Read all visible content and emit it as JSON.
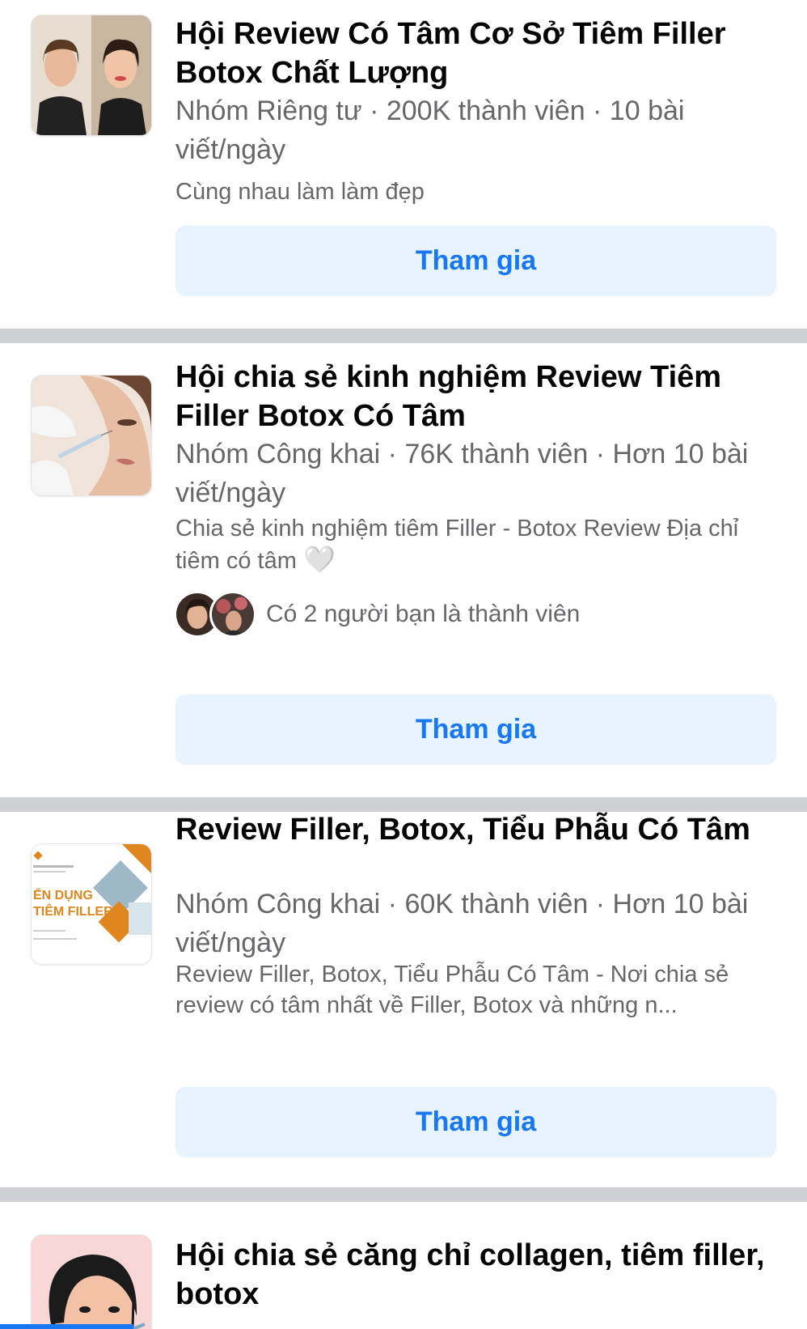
{
  "groups": [
    {
      "title": "Hội Review Có Tâm Cơ Sở Tiêm Filler Botox Chất Lượng",
      "meta": "Nhóm Riêng tư · 200K thành viên · 10 bài viết/ngày",
      "description": "Cùng nhau làm làm đẹp",
      "join_label": "Tham gia",
      "thumbnail_icon": "two-women-portrait-image"
    },
    {
      "title": "Hội chia sẻ kinh nghiệm Review Tiêm Filler Botox Có Tâm",
      "meta": "Nhóm Công khai · 76K thành viên · Hơn 10 bài viết/ngày",
      "description": "Chia sẻ kinh nghiệm tiêm Filler - Botox Review Địa chỉ tiêm có tâm",
      "description_emoji": "🤍",
      "friends_text": "Có 2 người bạn là thành viên",
      "join_label": "Tham gia",
      "thumbnail_icon": "face-injection-image"
    },
    {
      "title": "Review Filler, Botox, Tiểu Phẫu Có Tâm",
      "meta": "Nhóm Công khai · 60K thành viên · Hơn 10 bài viết/ngày",
      "description": "Review Filler, Botox, Tiểu Phẫu Có Tâm - Nơi chia sẻ review có tâm nhất về Filler, Botox và những n...",
      "join_label": "Tham gia",
      "thumbnail_icon": "recruitment-poster-image"
    },
    {
      "title": "Hội chia sẻ căng chỉ collagen, tiêm filler, botox",
      "thumbnail_icon": "cartoon-face-image"
    }
  ],
  "thumbnail_texts": {
    "poster_line1": "ỂN DỤNG",
    "poster_line2": "TIÊM FILLER"
  },
  "colors": {
    "accent": "#1877f2",
    "button_bg": "#e7f3ff",
    "separator": "#ced0d4",
    "secondary_text": "#65676b"
  }
}
